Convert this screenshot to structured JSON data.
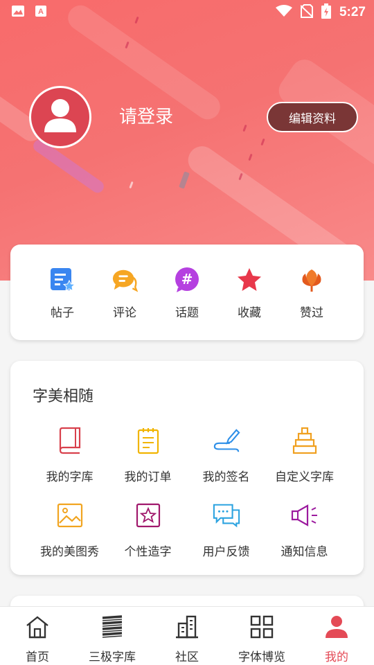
{
  "status_bar": {
    "time": "5:27",
    "left_icons": [
      "image-icon",
      "app-icon"
    ],
    "right_icons": [
      "wifi-icon",
      "no-sim-icon",
      "battery-charging-icon"
    ]
  },
  "profile": {
    "login_prompt": "请登录",
    "edit_button": "编辑资料"
  },
  "quick_actions": [
    {
      "label": "帖子",
      "icon": "post-icon"
    },
    {
      "label": "评论",
      "icon": "comment-icon"
    },
    {
      "label": "话题",
      "icon": "topic-icon"
    },
    {
      "label": "收藏",
      "icon": "star-icon"
    },
    {
      "label": "赞过",
      "icon": "like-icon"
    }
  ],
  "section": {
    "title": "字美相随",
    "items": [
      {
        "label": "我的字库",
        "icon": "book-icon"
      },
      {
        "label": "我的订单",
        "icon": "order-icon"
      },
      {
        "label": "我的签名",
        "icon": "signature-icon"
      },
      {
        "label": "自定义字库",
        "icon": "tower-icon"
      },
      {
        "label": "我的美图秀",
        "icon": "picture-icon"
      },
      {
        "label": "个性造字",
        "icon": "star-frame-icon"
      },
      {
        "label": "用户反馈",
        "icon": "feedback-icon"
      },
      {
        "label": "通知信息",
        "icon": "megaphone-icon"
      }
    ]
  },
  "tabs": [
    {
      "label": "首页",
      "icon": "home-icon"
    },
    {
      "label": "三极字库",
      "icon": "stack-icon"
    },
    {
      "label": "社区",
      "icon": "building-icon"
    },
    {
      "label": "字体博览",
      "icon": "grid-icon"
    },
    {
      "label": "我的",
      "icon": "user-icon",
      "active": true
    }
  ],
  "colors": {
    "accent": "#e44a56",
    "hero": "#f57272",
    "edit_button_bg": "#7a3636"
  }
}
